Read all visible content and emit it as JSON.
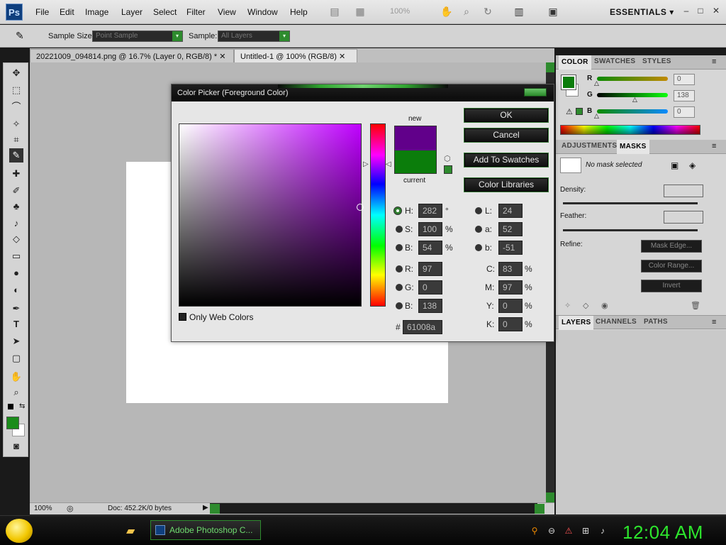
{
  "app": {
    "logo": "Ps",
    "menu": [
      "File",
      "Edit",
      "Image",
      "Layer",
      "Select",
      "Filter",
      "View",
      "Window",
      "Help"
    ],
    "zoom_display": "100%",
    "workspace": "ESSENTIALS",
    "window_controls": [
      "–",
      "□",
      "✕"
    ]
  },
  "options": {
    "sample_size_label": "Sample Size:",
    "sample_size_value": "Point Sample",
    "sample_label": "Sample:",
    "sample_value": "All Layers"
  },
  "tabs": [
    {
      "label": "20221009_094814.png @ 16.7% (Layer 0, RGB/8) *",
      "close": "✕"
    },
    {
      "label": "Untitled-1 @ 100% (RGB/8)",
      "close": "✕"
    }
  ],
  "colors": {
    "foreground": "#1a8c1a",
    "new_color": "#61008a",
    "current_color": "#0b7d0b",
    "accent_green": "#2e8b2e"
  },
  "status": {
    "zoom": "100%",
    "doc": "Doc: 452.2K/0 bytes"
  },
  "color_panel": {
    "tabs": [
      "COLOR",
      "SWATCHES",
      "STYLES"
    ],
    "channels": [
      {
        "label": "R",
        "value": "0"
      },
      {
        "label": "G",
        "value": "138"
      },
      {
        "label": "B",
        "value": "0"
      }
    ]
  },
  "masks_panel": {
    "tabs": [
      "ADJUSTMENTS",
      "MASKS"
    ],
    "no_mask": "No mask selected",
    "density_label": "Density:",
    "feather_label": "Feather:",
    "refine_label": "Refine:",
    "mask_edge": "Mask Edge...",
    "color_range": "Color Range...",
    "invert": "Invert"
  },
  "layers_panel": {
    "tabs": [
      "LAYERS",
      "CHANNELS",
      "PATHS"
    ]
  },
  "dialog": {
    "title": "Color Picker (Foreground Color)",
    "new_label": "new",
    "current_label": "current",
    "ok": "OK",
    "cancel": "Cancel",
    "add_to_swatches": "Add To Swatches",
    "color_libraries": "Color Libraries",
    "only_web_colors": "Only Web Colors",
    "hsb": [
      {
        "label": "H:",
        "value": "282",
        "unit": "°",
        "selected": true
      },
      {
        "label": "S:",
        "value": "100",
        "unit": "%"
      },
      {
        "label": "B:",
        "value": "54",
        "unit": "%"
      }
    ],
    "rgb": [
      {
        "label": "R:",
        "value": "97"
      },
      {
        "label": "G:",
        "value": "0"
      },
      {
        "label": "B:",
        "value": "138"
      }
    ],
    "lab": [
      {
        "label": "L:",
        "value": "24"
      },
      {
        "label": "a:",
        "value": "52"
      },
      {
        "label": "b:",
        "value": "-51"
      }
    ],
    "cmyk": [
      {
        "label": "C:",
        "value": "83",
        "unit": "%"
      },
      {
        "label": "M:",
        "value": "97",
        "unit": "%"
      },
      {
        "label": "Y:",
        "value": "0",
        "unit": "%"
      },
      {
        "label": "K:",
        "value": "0",
        "unit": "%"
      }
    ],
    "hex_label": "#",
    "hex_value": "61008a"
  },
  "taskbar": {
    "task": "Adobe Photoshop C...",
    "clock": "12:04 AM"
  }
}
